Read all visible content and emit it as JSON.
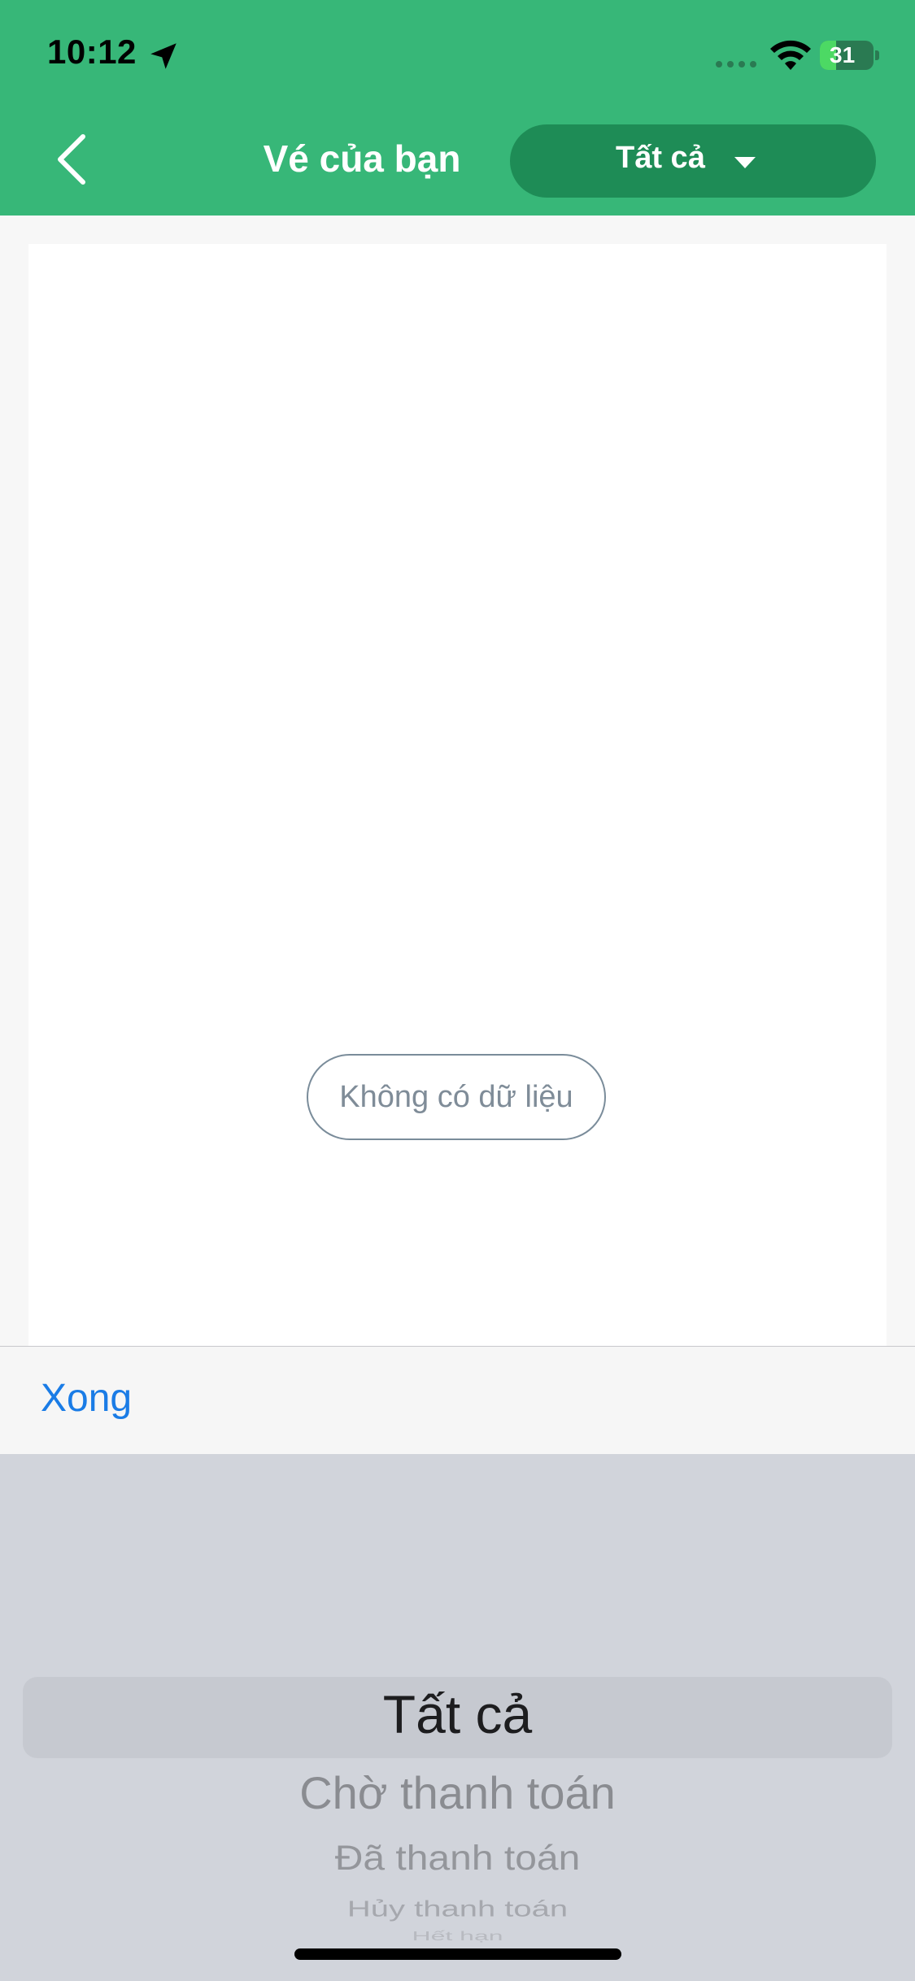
{
  "status_bar": {
    "time": "10:12",
    "battery": "31",
    "icons": [
      "location-arrow-icon",
      "wifi-icon",
      "battery-charging-icon"
    ]
  },
  "nav": {
    "title": "Vé của bạn",
    "filter_label": "Tất cả",
    "back_icon": "chevron-left-icon",
    "filter_icon": "caret-down-icon"
  },
  "content": {
    "empty_message": "Không có dữ liệu"
  },
  "picker": {
    "done_label": "Xong",
    "selected": "Tất cả",
    "options": [
      "Tất cả",
      "Chờ thanh toán",
      "Đã thanh toán",
      "Hủy thanh toán",
      "Hết hạn"
    ]
  },
  "colors": {
    "header": "#37b778",
    "filter_button": "#1e8c56",
    "done_link": "#1a7ce6",
    "picker_bg": "#d1d4db"
  }
}
